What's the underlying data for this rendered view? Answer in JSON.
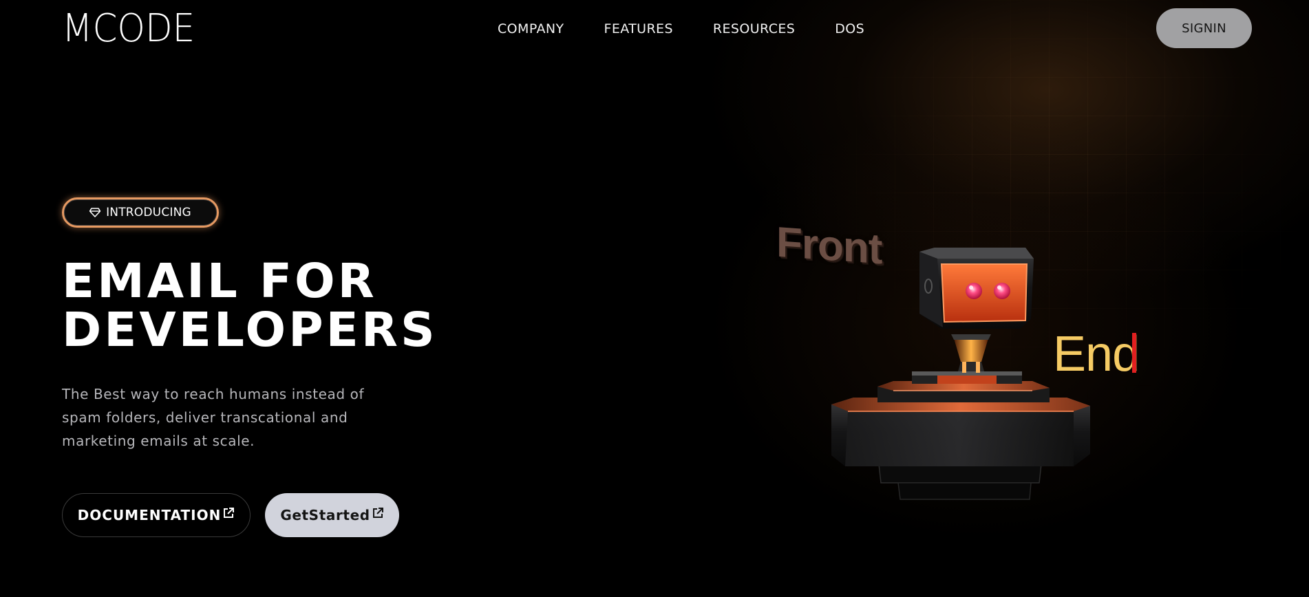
{
  "header": {
    "logo": "MCODE",
    "nav": [
      "COMPANY",
      "FEATURES",
      "RESOURCES",
      "DOS"
    ],
    "signin_label": "SIGNIN"
  },
  "hero": {
    "badge_label": "INTRODUCING",
    "badge_icon": "diamond-icon",
    "title_line1": "EMAIL FOR",
    "title_line2": "DEVELOPERS",
    "description": "The Best way to reach humans instead of spam folders, deliver transcational and marketing emails at scale.",
    "primary_button_label": "DOCUMENTATION",
    "secondary_button_label": "GetStarted",
    "button_icon": "external-link-icon"
  },
  "illustration": {
    "word_left": "Front",
    "word_right": "End",
    "subject": "robot-on-pedestal",
    "accent_color": "#e79a62",
    "robot_color": "#e2542a"
  }
}
